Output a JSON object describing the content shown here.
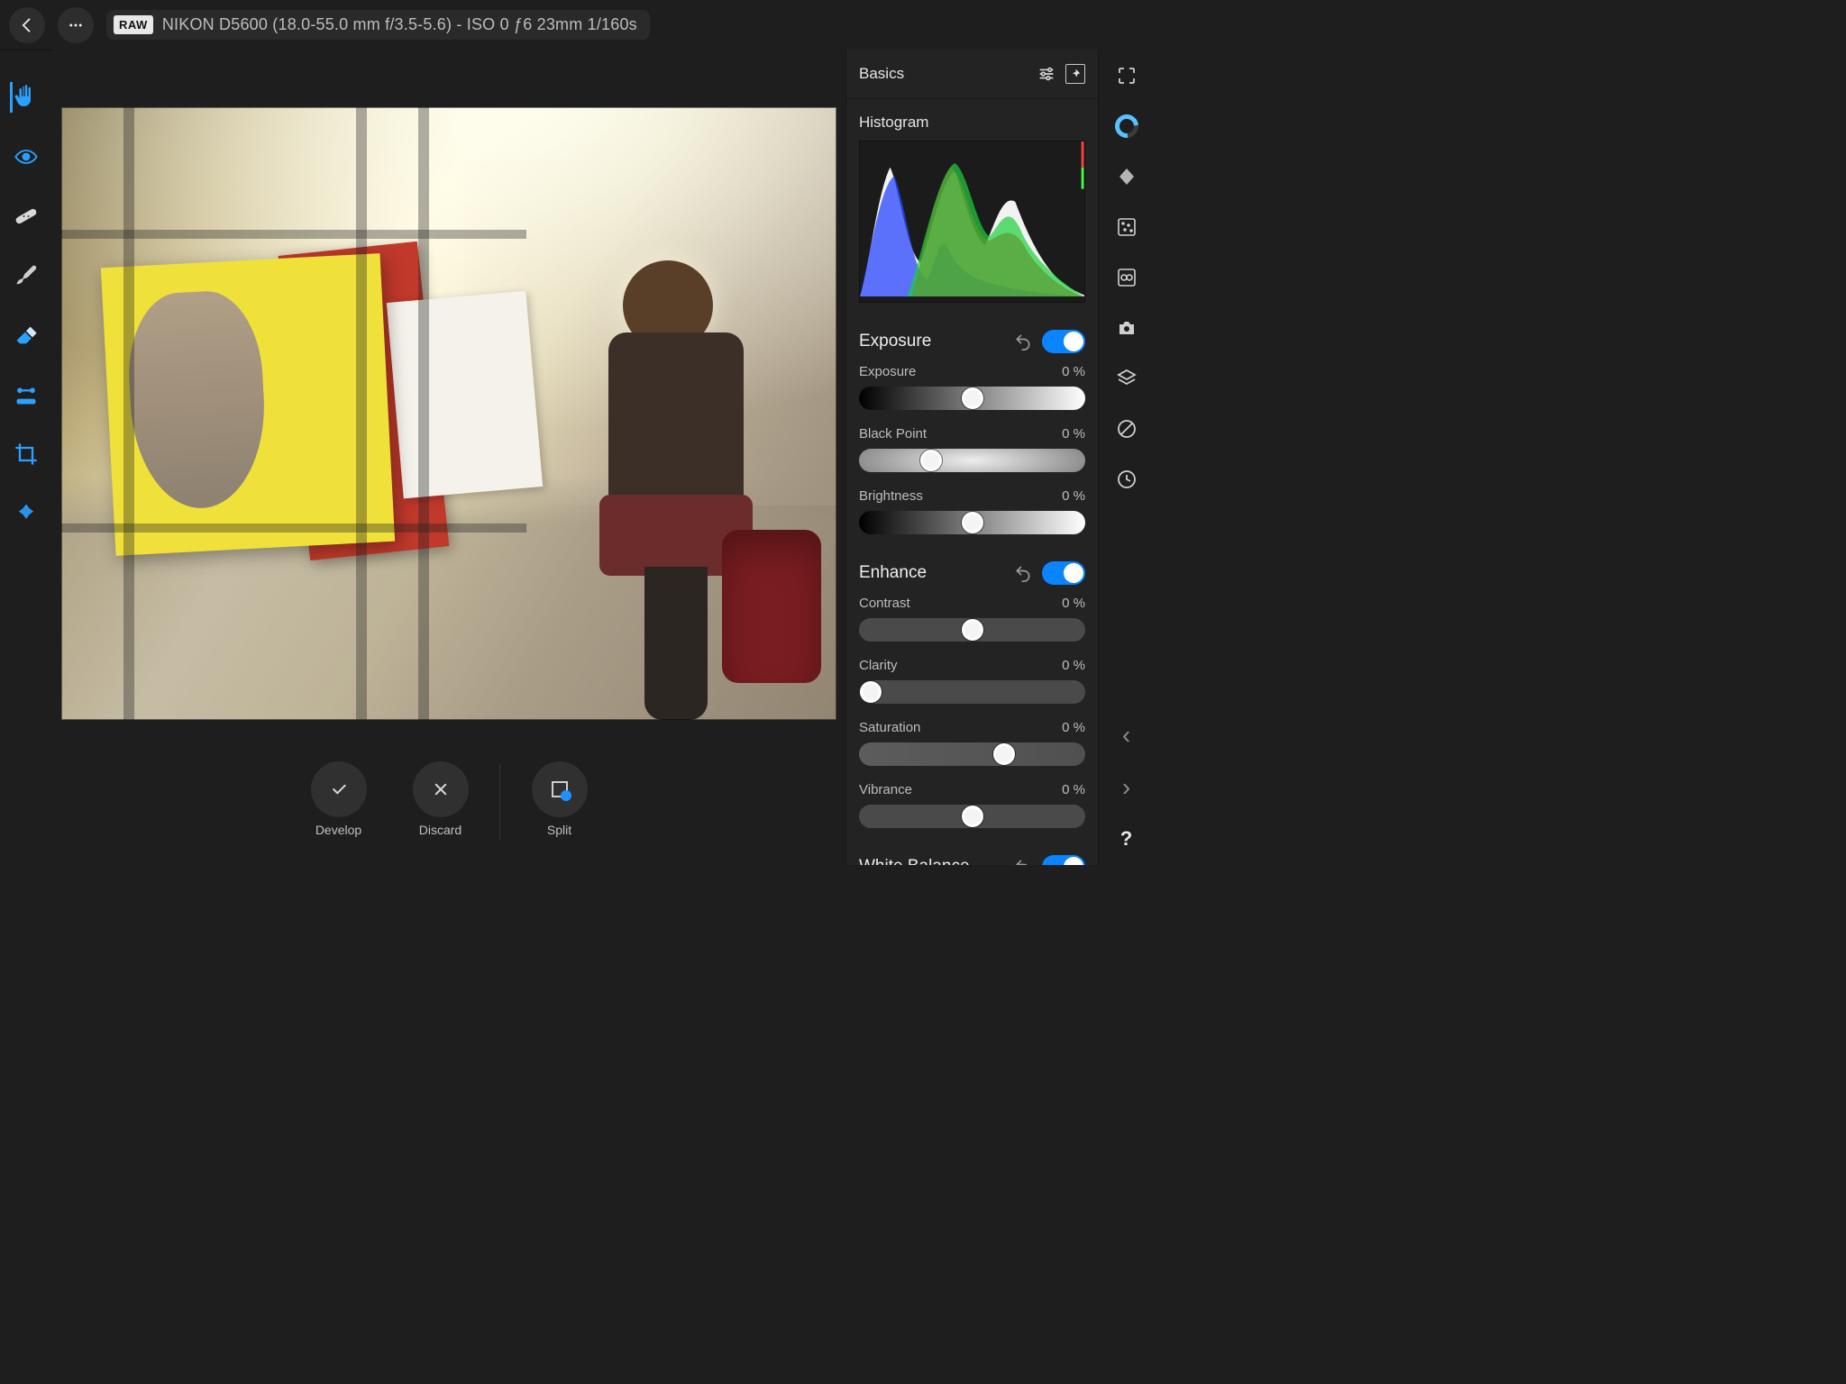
{
  "header": {
    "raw_badge": "RAW",
    "meta": "NIKON D5600 (18.0-55.0 mm f/3.5-5.6) - ISO 0 ƒ6 23mm 1/160s"
  },
  "left_tools": [
    {
      "name": "hand-tool",
      "active": true
    },
    {
      "name": "redeye-tool",
      "active": false
    },
    {
      "name": "bandage-tool",
      "active": false
    },
    {
      "name": "brush-tool",
      "active": false
    },
    {
      "name": "eraser-tool",
      "active": false
    },
    {
      "name": "gradient-tool",
      "active": false
    },
    {
      "name": "crop-tool",
      "active": false
    },
    {
      "name": "overlay-tool",
      "active": false
    }
  ],
  "bottom_actions": {
    "develop": "Develop",
    "discard": "Discard",
    "split": "Split"
  },
  "inspector": {
    "title": "Basics",
    "histogram_label": "Histogram",
    "groups": [
      {
        "key": "exposure",
        "name": "Exposure",
        "toggle_on": true,
        "params": [
          {
            "key": "exposure",
            "label": "Exposure",
            "value_text": "0 %",
            "thumb_pct": 50,
            "style": "grad-bw"
          },
          {
            "key": "blackpoint",
            "label": "Black Point",
            "value_text": "0 %",
            "thumb_pct": 32,
            "style": "grad-bp"
          },
          {
            "key": "brightness",
            "label": "Brightness",
            "value_text": "0 %",
            "thumb_pct": 50,
            "style": "grad-bw"
          }
        ]
      },
      {
        "key": "enhance",
        "name": "Enhance",
        "toggle_on": true,
        "params": [
          {
            "key": "contrast",
            "label": "Contrast",
            "value_text": "0 %",
            "thumb_pct": 50,
            "style": "grad-gray"
          },
          {
            "key": "clarity",
            "label": "Clarity",
            "value_text": "0 %",
            "thumb_pct": 5,
            "style": "grad-gray"
          },
          {
            "key": "saturation",
            "label": "Saturation",
            "value_text": "0 %",
            "thumb_pct": 64,
            "style": "grad-sat"
          },
          {
            "key": "vibrance",
            "label": "Vibrance",
            "value_text": "0 %",
            "thumb_pct": 50,
            "style": "grad-gray"
          }
        ]
      },
      {
        "key": "whitebalance",
        "name": "White Balance",
        "toggle_on": true,
        "params": []
      }
    ]
  },
  "right_sidebar": [
    "fit-icon",
    "donut-icon",
    "transform-icon",
    "noise-icon",
    "channels-icon",
    "camera-icon",
    "layers-icon",
    "scope-icon",
    "history-icon"
  ]
}
